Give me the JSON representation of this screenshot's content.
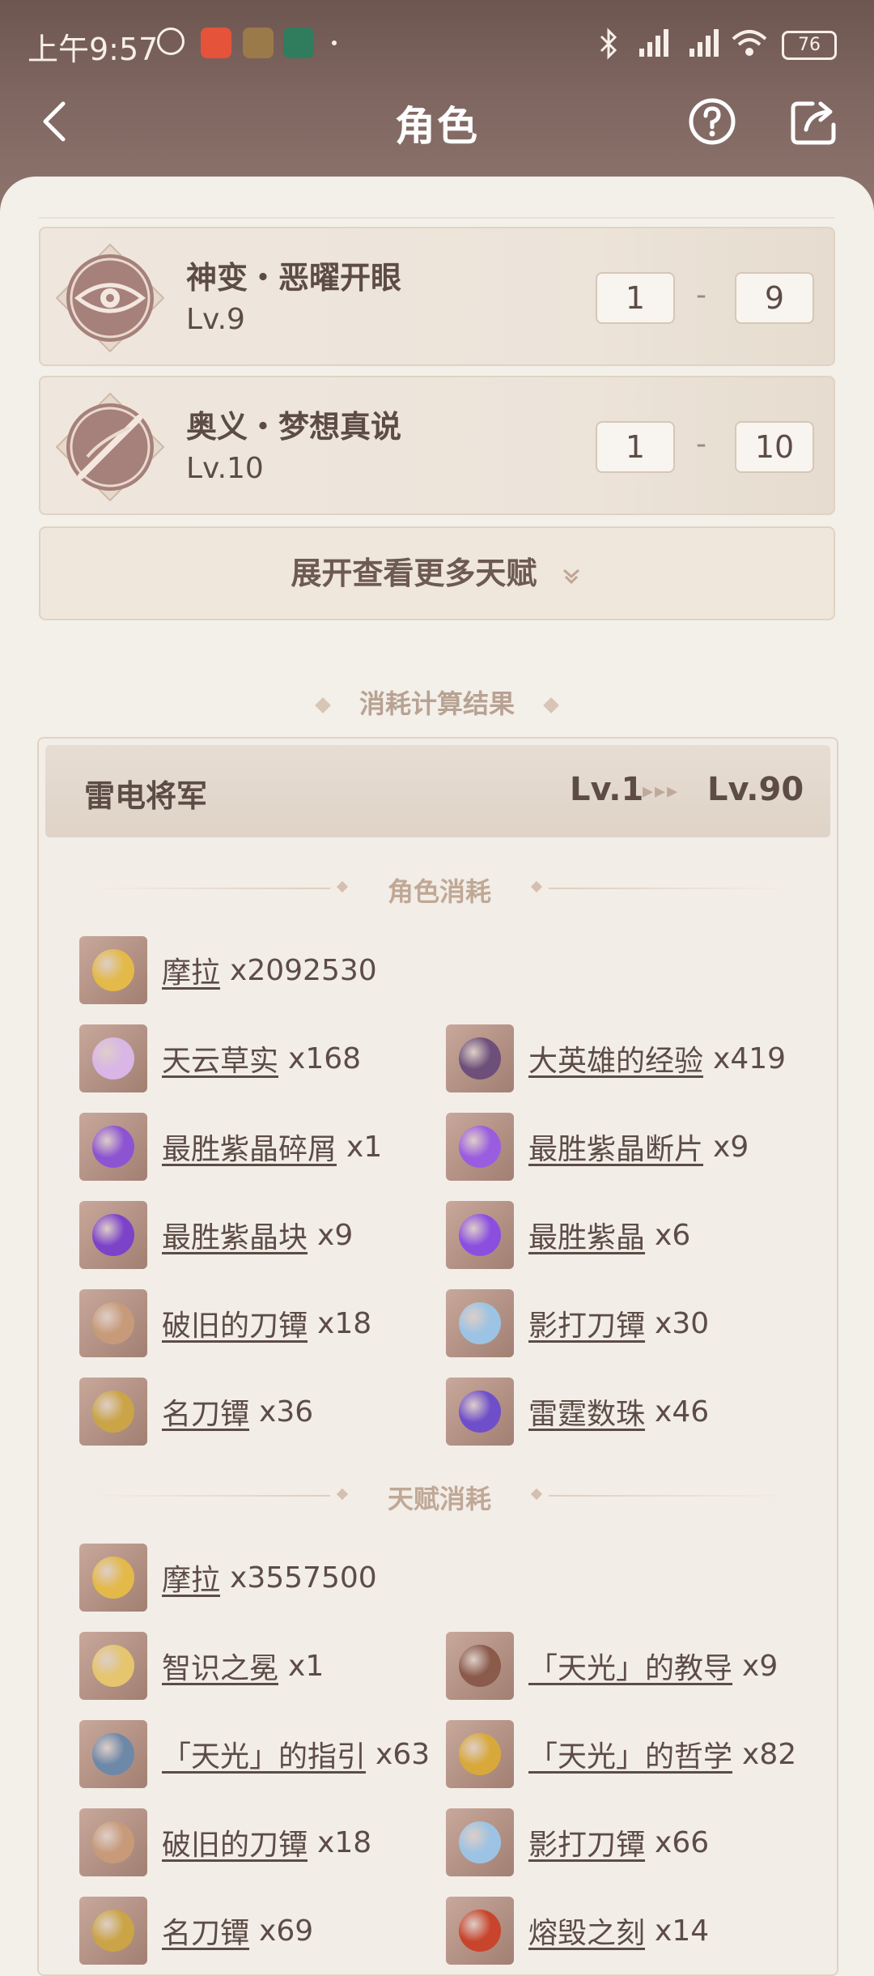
{
  "status": {
    "time": "上午9:57",
    "battery": "76"
  },
  "nav": {
    "title": "角色"
  },
  "talents": [
    {
      "name": "神变・恶曜开眼",
      "level": "Lv.9",
      "from": "1",
      "to": "9",
      "icon": "eye-emblem-icon"
    },
    {
      "name": "奥义・梦想真说",
      "level": "Lv.10",
      "from": "1",
      "to": "10",
      "icon": "sword-emblem-icon"
    }
  ],
  "expand_label": "展开查看更多天赋",
  "result_section_title": "消耗计算结果",
  "result": {
    "character": "雷电将军",
    "from_level": "Lv.1",
    "to_level": "Lv.90",
    "character_cost_title": "角色消耗",
    "talent_cost_title": "天赋消耗",
    "character_items": [
      {
        "name": "摩拉",
        "qty": "x2092530",
        "color": "#e3b94a"
      },
      {
        "name": "天云草实",
        "qty": "x168",
        "color": "#d9b6e6"
      },
      {
        "name": "大英雄的经验",
        "qty": "x419",
        "color": "#6d4f7a"
      },
      {
        "name": "最胜紫晶碎屑",
        "qty": "x1",
        "color": "#8d54d1"
      },
      {
        "name": "最胜紫晶断片",
        "qty": "x9",
        "color": "#9a5de0"
      },
      {
        "name": "最胜紫晶块",
        "qty": "x9",
        "color": "#7c43c9"
      },
      {
        "name": "最胜紫晶",
        "qty": "x6",
        "color": "#8b4fe0"
      },
      {
        "name": "破旧的刀镡",
        "qty": "x18",
        "color": "#c79a7a"
      },
      {
        "name": "影打刀镡",
        "qty": "x30",
        "color": "#9cc3e3"
      },
      {
        "name": "名刀镡",
        "qty": "x36",
        "color": "#caa447"
      },
      {
        "name": "雷霆数珠",
        "qty": "x46",
        "color": "#6f4fc9"
      }
    ],
    "talent_items": [
      {
        "name": "摩拉",
        "qty": "x3557500",
        "color": "#e3b94a"
      },
      {
        "name": "智识之冕",
        "qty": "x1",
        "color": "#e5c56d"
      },
      {
        "name": "「天光」的教导",
        "qty": "x9",
        "color": "#8a5a4a"
      },
      {
        "name": "「天光」的指引",
        "qty": "x63",
        "color": "#6e88a8"
      },
      {
        "name": "「天光」的哲学",
        "qty": "x82",
        "color": "#d8a93a"
      },
      {
        "name": "破旧的刀镡",
        "qty": "x18",
        "color": "#c79a7a"
      },
      {
        "name": "影打刀镡",
        "qty": "x66",
        "color": "#9cc3e3"
      },
      {
        "name": "名刀镡",
        "qty": "x69",
        "color": "#caa447"
      },
      {
        "name": "熔毁之刻",
        "qty": "x14",
        "color": "#c8442c"
      }
    ]
  }
}
